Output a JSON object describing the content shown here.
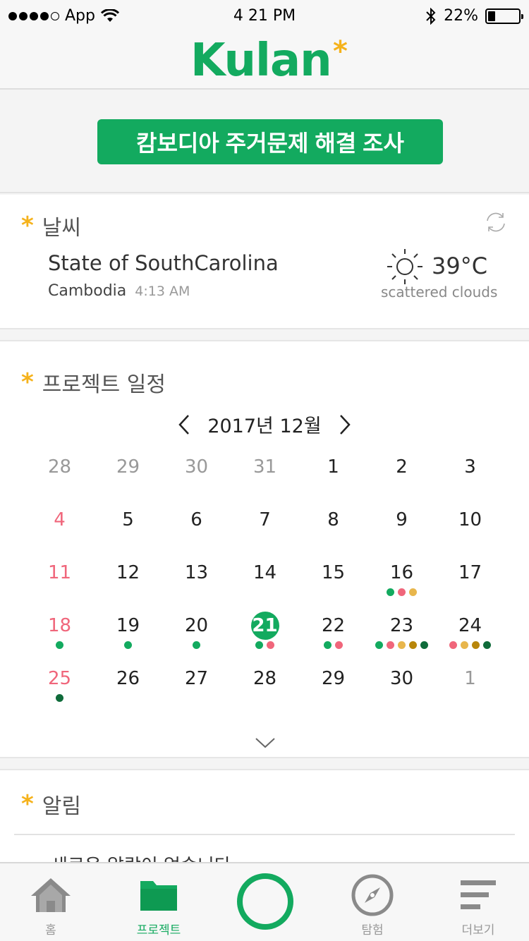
{
  "status_bar": {
    "carrier": "App",
    "time": "4 21 PM",
    "battery": "22%"
  },
  "header": {
    "logo": "Kulan",
    "logo_mark": "*"
  },
  "banner": {
    "label": "캄보디아 주거문제 해결 조사"
  },
  "weather": {
    "title": "날씨",
    "location": "State of SouthCarolina",
    "country": "Cambodia",
    "local_time": "4:13 AM",
    "temperature": "39°C",
    "description": "scattered clouds",
    "icon": "sun-icon"
  },
  "calendar": {
    "title": "프로젝트 일정",
    "month": "2017년 12월",
    "colors": {
      "green": "#13aa5f",
      "pink": "#f0667b",
      "yellow": "#e8b64c",
      "olive": "#b8860b",
      "darkgreen": "#0f6b3a"
    },
    "weeks": [
      [
        {
          "d": "28",
          "t": "muted"
        },
        {
          "d": "29",
          "t": "muted"
        },
        {
          "d": "30",
          "t": "muted"
        },
        {
          "d": "31",
          "t": "muted"
        },
        {
          "d": "1"
        },
        {
          "d": "2"
        },
        {
          "d": "3"
        }
      ],
      [
        {
          "d": "4",
          "t": "sunday"
        },
        {
          "d": "5"
        },
        {
          "d": "6"
        },
        {
          "d": "7"
        },
        {
          "d": "8"
        },
        {
          "d": "9"
        },
        {
          "d": "10"
        }
      ],
      [
        {
          "d": "11",
          "t": "sunday"
        },
        {
          "d": "12"
        },
        {
          "d": "13"
        },
        {
          "d": "14"
        },
        {
          "d": "15"
        },
        {
          "d": "16",
          "dots": [
            "green",
            "pink",
            "yellow"
          ]
        },
        {
          "d": "17"
        }
      ],
      [
        {
          "d": "18",
          "t": "sunday",
          "dots": [
            "green"
          ]
        },
        {
          "d": "19",
          "dots": [
            "green"
          ]
        },
        {
          "d": "20",
          "dots": [
            "green"
          ]
        },
        {
          "d": "21",
          "t": "today",
          "dots": [
            "green",
            "pink"
          ]
        },
        {
          "d": "22",
          "dots": [
            "green",
            "pink"
          ]
        },
        {
          "d": "23",
          "dots": [
            "green",
            "pink",
            "yellow",
            "olive",
            "darkgreen"
          ]
        },
        {
          "d": "24",
          "dots": [
            "pink",
            "yellow",
            "olive",
            "darkgreen"
          ]
        }
      ],
      [
        {
          "d": "25",
          "t": "sunday",
          "dots": [
            "darkgreen"
          ]
        },
        {
          "d": "26"
        },
        {
          "d": "27"
        },
        {
          "d": "28"
        },
        {
          "d": "29"
        },
        {
          "d": "30"
        },
        {
          "d": "1",
          "t": "muted"
        }
      ]
    ]
  },
  "notice": {
    "title": "알림",
    "text": "새로운 알람이 없습니다"
  },
  "tabs": [
    {
      "label": "홈",
      "icon": "home-icon"
    },
    {
      "label": "프로젝트",
      "icon": "folder-icon",
      "active": true
    },
    {
      "label": "",
      "icon": "center-ring-icon"
    },
    {
      "label": "탐험",
      "icon": "compass-icon"
    },
    {
      "label": "더보기",
      "icon": "menu-icon"
    }
  ]
}
